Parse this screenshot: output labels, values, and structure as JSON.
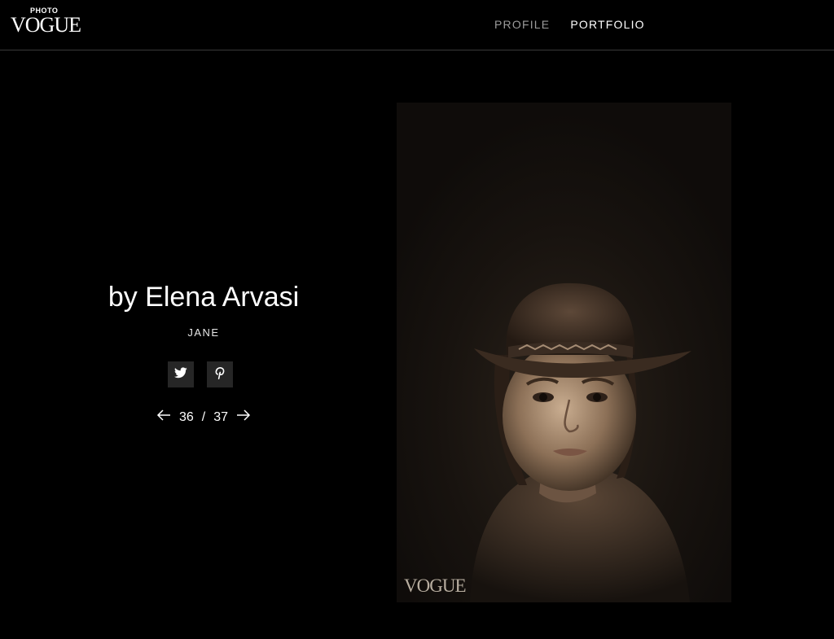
{
  "header": {
    "logo_small": "PHOTO",
    "logo_large": "VOGUE",
    "nav": {
      "profile": "PROFILE",
      "portfolio": "PORTFOLIO"
    }
  },
  "main": {
    "title": "by Elena Arvasi",
    "subtitle": "JANE",
    "share": {
      "twitter_icon": "twitter-icon",
      "pinterest_icon": "pinterest-icon"
    },
    "pager": {
      "current": "36",
      "separator": "/",
      "total": "37",
      "prev_icon": "arrow-left-icon",
      "next_icon": "arrow-right-icon"
    }
  },
  "photo": {
    "watermark": "VOGUE"
  },
  "colors": {
    "background": "#000000",
    "nav_inactive": "#9c9c9c",
    "nav_active": "#ffffff",
    "share_button_bg": "#262626",
    "photo_tone": "#17130f"
  }
}
